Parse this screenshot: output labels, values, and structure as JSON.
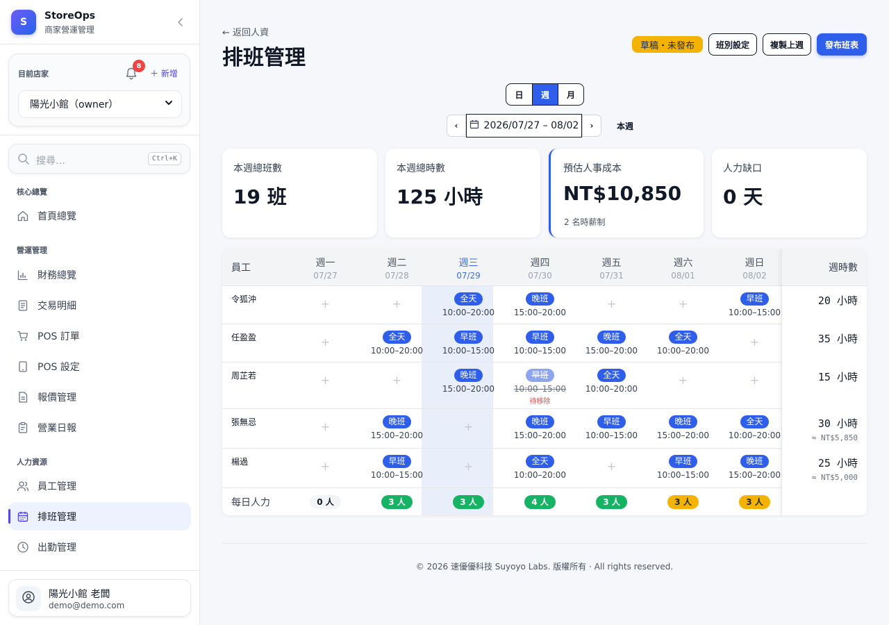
{
  "brand": {
    "logo_letter": "S",
    "name": "StoreOps",
    "subtitle": "商家營運管理",
    "collapse_icon": "chevron-left-icon"
  },
  "store": {
    "label": "目前店家",
    "notification_count": "8",
    "add_label": "＋ 新增",
    "selected": "陽光小館（owner）"
  },
  "search": {
    "placeholder": "搜尋…",
    "shortcut": "Ctrl+K"
  },
  "nav": {
    "sections": [
      {
        "title": "核心總覽",
        "items": [
          {
            "label": "首頁總覽",
            "icon": "home-icon"
          }
        ]
      },
      {
        "title": "營運管理",
        "items": [
          {
            "label": "財務總覽",
            "icon": "bar-chart-icon"
          },
          {
            "label": "交易明細",
            "icon": "document-icon"
          },
          {
            "label": "POS 訂單",
            "icon": "cart-icon"
          },
          {
            "label": "POS 設定",
            "icon": "tablet-icon"
          },
          {
            "label": "報價管理",
            "icon": "file-text-icon"
          },
          {
            "label": "營業日報",
            "icon": "clipboard-icon"
          }
        ]
      },
      {
        "title": "人力資源",
        "items": [
          {
            "label": "員工管理",
            "icon": "users-icon"
          },
          {
            "label": "排班管理",
            "icon": "calendar-icon",
            "active": true
          },
          {
            "label": "出勤管理",
            "icon": "clock-icon"
          }
        ]
      }
    ]
  },
  "user": {
    "name": "陽光小館 老闆",
    "email": "demo@demo.com"
  },
  "header": {
    "back_label": "← 返回人資",
    "title": "排班管理",
    "status_badge": "草稿・未發布",
    "shift_settings": "班別設定",
    "copy_last_week": "複製上週",
    "publish": "發布班表"
  },
  "view": {
    "options": [
      "日",
      "週",
      "月"
    ],
    "selected": "週"
  },
  "date_nav": {
    "prev": "‹",
    "next": "›",
    "range": "2026/07/27 – 08/02",
    "this_week": "本週"
  },
  "stats": [
    {
      "label": "本週總班數",
      "value": "19 班",
      "sub": ""
    },
    {
      "label": "本週總時數",
      "value": "125 小時",
      "sub": ""
    },
    {
      "label": "預估人事成本",
      "value": "NT$10,850",
      "sub": "2 名時薪制",
      "accent": true
    },
    {
      "label": "人力缺口",
      "value": "0 天",
      "sub": ""
    }
  ],
  "schedule": {
    "employee_header": "員工",
    "hours_header": "週時數",
    "today_index": 2,
    "days": [
      {
        "name": "週一",
        "date": "07/27"
      },
      {
        "name": "週二",
        "date": "07/28"
      },
      {
        "name": "週三",
        "date": "07/29"
      },
      {
        "name": "週四",
        "date": "07/30"
      },
      {
        "name": "週五",
        "date": "07/31"
      },
      {
        "name": "週六",
        "date": "08/01"
      },
      {
        "name": "週日",
        "date": "08/02"
      }
    ],
    "empty_symbol": "+",
    "pending_label": "待移除",
    "rows": [
      {
        "name": "令狐沖",
        "hours": "20 小時",
        "cost": "",
        "shifts": [
          null,
          null,
          {
            "label": "全天",
            "time": "10:00–20:00"
          },
          {
            "label": "晚班",
            "time": "15:00–20:00"
          },
          null,
          null,
          {
            "label": "早班",
            "time": "10:00–15:00"
          }
        ]
      },
      {
        "name": "任盈盈",
        "hours": "35 小時",
        "cost": "",
        "shifts": [
          null,
          {
            "label": "全天",
            "time": "10:00–20:00"
          },
          {
            "label": "早班",
            "time": "10:00–15:00"
          },
          {
            "label": "早班",
            "time": "10:00–15:00"
          },
          {
            "label": "晚班",
            "time": "15:00–20:00"
          },
          {
            "label": "全天",
            "time": "10:00–20:00"
          },
          null
        ]
      },
      {
        "name": "周芷若",
        "hours": "15 小時",
        "cost": "",
        "shifts": [
          null,
          null,
          {
            "label": "晚班",
            "time": "15:00–20:00"
          },
          {
            "label": "早班",
            "time": "10:00–15:00",
            "removed": true
          },
          {
            "label": "全天",
            "time": "10:00–20:00"
          },
          null,
          null
        ]
      },
      {
        "name": "張無忌",
        "hours": "30 小時",
        "cost": "≈ NT$5,850",
        "shifts": [
          null,
          {
            "label": "晚班",
            "time": "15:00–20:00"
          },
          null,
          {
            "label": "晚班",
            "time": "15:00–20:00"
          },
          {
            "label": "早班",
            "time": "10:00–15:00"
          },
          {
            "label": "晚班",
            "time": "15:00–20:00"
          },
          {
            "label": "全天",
            "time": "10:00–20:00"
          }
        ]
      },
      {
        "name": "楊過",
        "hours": "25 小時",
        "cost": "≈ NT$5,000",
        "shifts": [
          null,
          {
            "label": "早班",
            "time": "10:00–15:00"
          },
          null,
          {
            "label": "全天",
            "time": "10:00–20:00"
          },
          null,
          {
            "label": "早班",
            "time": "10:00–15:00"
          },
          {
            "label": "晚班",
            "time": "15:00–20:00"
          }
        ]
      }
    ],
    "daily_label": "每日人力",
    "daily": [
      {
        "value": "0 人",
        "status": "gray"
      },
      {
        "value": "3 人",
        "status": "green"
      },
      {
        "value": "3 人",
        "status": "green"
      },
      {
        "value": "4 人",
        "status": "green"
      },
      {
        "value": "3 人",
        "status": "green"
      },
      {
        "value": "3 人",
        "status": "amber"
      },
      {
        "value": "3 人",
        "status": "amber"
      }
    ]
  },
  "footer": {
    "copyright": "© 2026 速優優科技 Suyoyo Labs. 版權所有 · All rights reserved."
  },
  "colors": {
    "primary": "#2f5fea",
    "accent": "#4f46e5",
    "warning": "#f5b301",
    "success": "#16b364",
    "danger": "#ef4444",
    "today_column": "#e9eefb"
  }
}
